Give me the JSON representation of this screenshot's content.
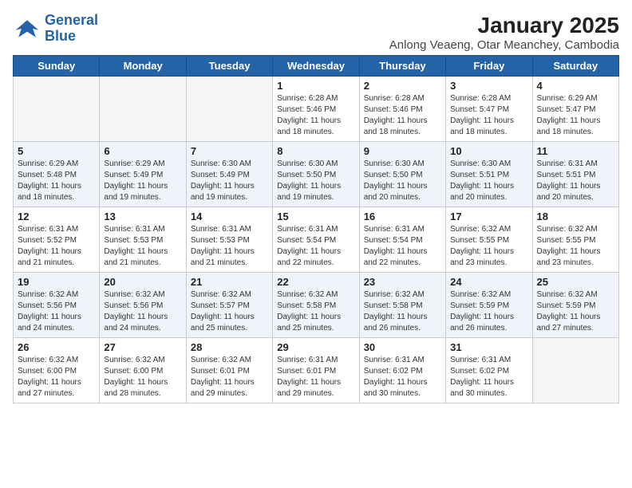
{
  "header": {
    "logo_line1": "General",
    "logo_line2": "Blue",
    "title": "January 2025",
    "subtitle": "Anlong Veaeng, Otar Meanchey, Cambodia"
  },
  "weekdays": [
    "Sunday",
    "Monday",
    "Tuesday",
    "Wednesday",
    "Thursday",
    "Friday",
    "Saturday"
  ],
  "weeks": [
    [
      {
        "num": "",
        "info": ""
      },
      {
        "num": "",
        "info": ""
      },
      {
        "num": "",
        "info": ""
      },
      {
        "num": "1",
        "info": "Sunrise: 6:28 AM\nSunset: 5:46 PM\nDaylight: 11 hours and 18 minutes."
      },
      {
        "num": "2",
        "info": "Sunrise: 6:28 AM\nSunset: 5:46 PM\nDaylight: 11 hours and 18 minutes."
      },
      {
        "num": "3",
        "info": "Sunrise: 6:28 AM\nSunset: 5:47 PM\nDaylight: 11 hours and 18 minutes."
      },
      {
        "num": "4",
        "info": "Sunrise: 6:29 AM\nSunset: 5:47 PM\nDaylight: 11 hours and 18 minutes."
      }
    ],
    [
      {
        "num": "5",
        "info": "Sunrise: 6:29 AM\nSunset: 5:48 PM\nDaylight: 11 hours and 18 minutes."
      },
      {
        "num": "6",
        "info": "Sunrise: 6:29 AM\nSunset: 5:49 PM\nDaylight: 11 hours and 19 minutes."
      },
      {
        "num": "7",
        "info": "Sunrise: 6:30 AM\nSunset: 5:49 PM\nDaylight: 11 hours and 19 minutes."
      },
      {
        "num": "8",
        "info": "Sunrise: 6:30 AM\nSunset: 5:50 PM\nDaylight: 11 hours and 19 minutes."
      },
      {
        "num": "9",
        "info": "Sunrise: 6:30 AM\nSunset: 5:50 PM\nDaylight: 11 hours and 20 minutes."
      },
      {
        "num": "10",
        "info": "Sunrise: 6:30 AM\nSunset: 5:51 PM\nDaylight: 11 hours and 20 minutes."
      },
      {
        "num": "11",
        "info": "Sunrise: 6:31 AM\nSunset: 5:51 PM\nDaylight: 11 hours and 20 minutes."
      }
    ],
    [
      {
        "num": "12",
        "info": "Sunrise: 6:31 AM\nSunset: 5:52 PM\nDaylight: 11 hours and 21 minutes."
      },
      {
        "num": "13",
        "info": "Sunrise: 6:31 AM\nSunset: 5:53 PM\nDaylight: 11 hours and 21 minutes."
      },
      {
        "num": "14",
        "info": "Sunrise: 6:31 AM\nSunset: 5:53 PM\nDaylight: 11 hours and 21 minutes."
      },
      {
        "num": "15",
        "info": "Sunrise: 6:31 AM\nSunset: 5:54 PM\nDaylight: 11 hours and 22 minutes."
      },
      {
        "num": "16",
        "info": "Sunrise: 6:31 AM\nSunset: 5:54 PM\nDaylight: 11 hours and 22 minutes."
      },
      {
        "num": "17",
        "info": "Sunrise: 6:32 AM\nSunset: 5:55 PM\nDaylight: 11 hours and 23 minutes."
      },
      {
        "num": "18",
        "info": "Sunrise: 6:32 AM\nSunset: 5:55 PM\nDaylight: 11 hours and 23 minutes."
      }
    ],
    [
      {
        "num": "19",
        "info": "Sunrise: 6:32 AM\nSunset: 5:56 PM\nDaylight: 11 hours and 24 minutes."
      },
      {
        "num": "20",
        "info": "Sunrise: 6:32 AM\nSunset: 5:56 PM\nDaylight: 11 hours and 24 minutes."
      },
      {
        "num": "21",
        "info": "Sunrise: 6:32 AM\nSunset: 5:57 PM\nDaylight: 11 hours and 25 minutes."
      },
      {
        "num": "22",
        "info": "Sunrise: 6:32 AM\nSunset: 5:58 PM\nDaylight: 11 hours and 25 minutes."
      },
      {
        "num": "23",
        "info": "Sunrise: 6:32 AM\nSunset: 5:58 PM\nDaylight: 11 hours and 26 minutes."
      },
      {
        "num": "24",
        "info": "Sunrise: 6:32 AM\nSunset: 5:59 PM\nDaylight: 11 hours and 26 minutes."
      },
      {
        "num": "25",
        "info": "Sunrise: 6:32 AM\nSunset: 5:59 PM\nDaylight: 11 hours and 27 minutes."
      }
    ],
    [
      {
        "num": "26",
        "info": "Sunrise: 6:32 AM\nSunset: 6:00 PM\nDaylight: 11 hours and 27 minutes."
      },
      {
        "num": "27",
        "info": "Sunrise: 6:32 AM\nSunset: 6:00 PM\nDaylight: 11 hours and 28 minutes."
      },
      {
        "num": "28",
        "info": "Sunrise: 6:32 AM\nSunset: 6:01 PM\nDaylight: 11 hours and 29 minutes."
      },
      {
        "num": "29",
        "info": "Sunrise: 6:31 AM\nSunset: 6:01 PM\nDaylight: 11 hours and 29 minutes."
      },
      {
        "num": "30",
        "info": "Sunrise: 6:31 AM\nSunset: 6:02 PM\nDaylight: 11 hours and 30 minutes."
      },
      {
        "num": "31",
        "info": "Sunrise: 6:31 AM\nSunset: 6:02 PM\nDaylight: 11 hours and 30 minutes."
      },
      {
        "num": "",
        "info": ""
      }
    ]
  ]
}
